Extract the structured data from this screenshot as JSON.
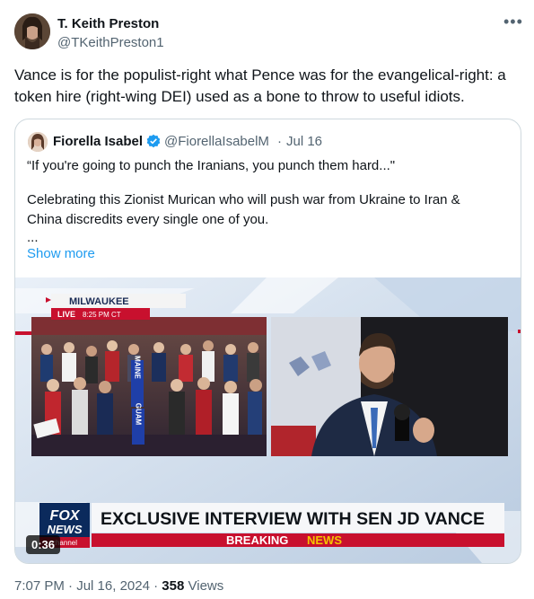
{
  "author": {
    "name": "T. Keith Preston",
    "handle": "@TKeithPreston1"
  },
  "more_icon": "more-horizontal-icon",
  "tweet_text": "Vance is for the populist-right what Pence was for the evangelical-right: a token hire (right-wing DEI) used as a bone to throw to useful idiots.",
  "quote": {
    "name": "Fiorella Isabel",
    "handle": "@FiorellaIsabelM",
    "separator": "·",
    "date": "Jul 16",
    "verified_color": "#1d9bf0",
    "lines": [
      "“If you're going to punch the Iranians, you punch them hard...\"",
      "Celebrating this Zionist Murican who will push war from Ukraine to Iran &",
      "China discredits every single one of you.",
      "..."
    ],
    "show_more": "Show more",
    "video": {
      "location": "MILWAUKEE",
      "live": "LIVE",
      "time": "8:25 PM CT",
      "banner": "EXCLUSIVE INTERVIEW WITH SEN JD VANCE",
      "sub_banner_prefix": "BREAKING",
      "sub_banner_suffix": "NEWS",
      "logo_top": "FOX",
      "logo_mid": "NEWS",
      "logo_bottom": "channel",
      "duration": "0:36",
      "sign_1": "MAINE",
      "sign_2": "GUAM"
    }
  },
  "footer": {
    "time": "7:07 PM",
    "sep1": "·",
    "date": "Jul 16, 2024",
    "sep2": "·",
    "views_count": "358",
    "views_label": "Views"
  }
}
